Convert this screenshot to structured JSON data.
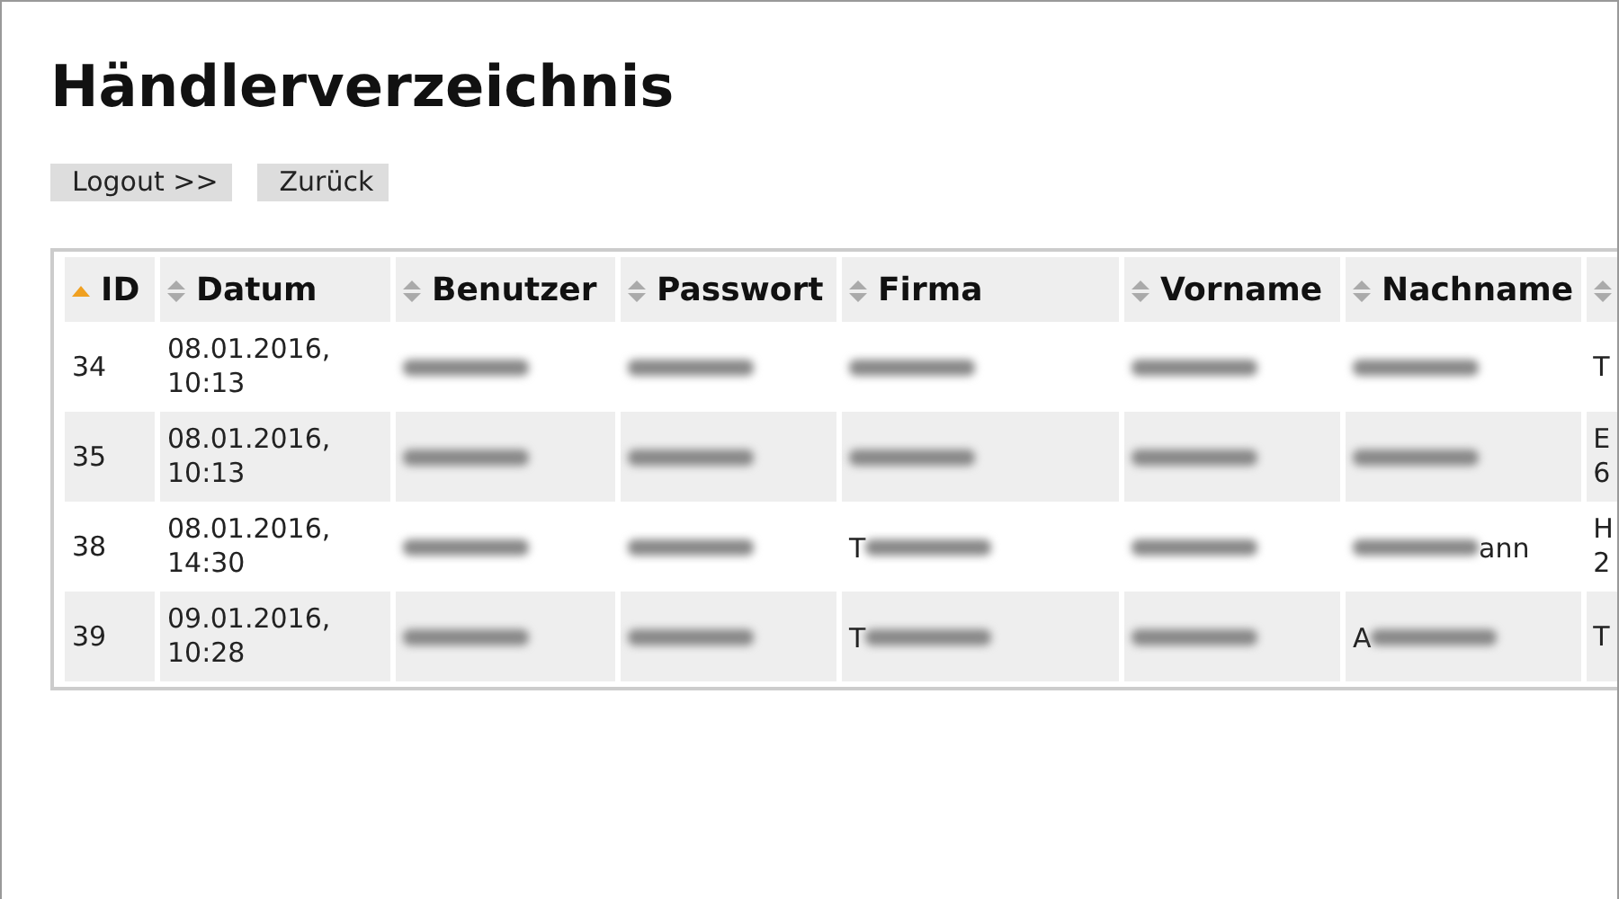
{
  "title": "Händlerverzeichnis",
  "buttons": [
    "Logout >>",
    "Zurück"
  ],
  "table": {
    "columns": [
      {
        "label": "ID",
        "sorted": true
      },
      {
        "label": "Datum",
        "sorted": false
      },
      {
        "label": "Benutzer",
        "sorted": false
      },
      {
        "label": "Passwort",
        "sorted": false
      },
      {
        "label": "Firma",
        "sorted": false
      },
      {
        "label": "Vorname",
        "sorted": false
      },
      {
        "label": "Nachname",
        "sorted": false
      },
      {
        "sorted": false
      }
    ],
    "rows": [
      [
        {
          "text": "34"
        },
        {
          "text": "08.01.2016, 10:13"
        },
        {
          "redacted": true
        },
        {
          "redacted": true
        },
        {
          "redacted": true
        },
        {
          "redacted": true
        },
        {
          "redacted": true
        },
        {
          "text": "T"
        }
      ],
      [
        {
          "text": "35"
        },
        {
          "text": "08.01.2016, 10:13"
        },
        {
          "redacted": true
        },
        {
          "redacted": true
        },
        {
          "redacted": true
        },
        {
          "redacted": true
        },
        {
          "redacted": true
        },
        {
          "text": "E 6"
        }
      ],
      [
        {
          "text": "38"
        },
        {
          "text": "08.01.2016, 14:30"
        },
        {
          "redacted": true
        },
        {
          "redacted": true
        },
        {
          "prefix": "T",
          "redacted": true
        },
        {
          "redacted": true
        },
        {
          "redacted": true,
          "suffix": "ann"
        },
        {
          "text": "H 2"
        }
      ],
      [
        {
          "text": "39"
        },
        {
          "text": "09.01.2016, 10:28"
        },
        {
          "redacted": true
        },
        {
          "redacted": true
        },
        {
          "prefix": "T",
          "redacted": true
        },
        {
          "redacted": true
        },
        {
          "prefix": "A",
          "redacted": true
        },
        {
          "text": "T"
        }
      ]
    ]
  }
}
